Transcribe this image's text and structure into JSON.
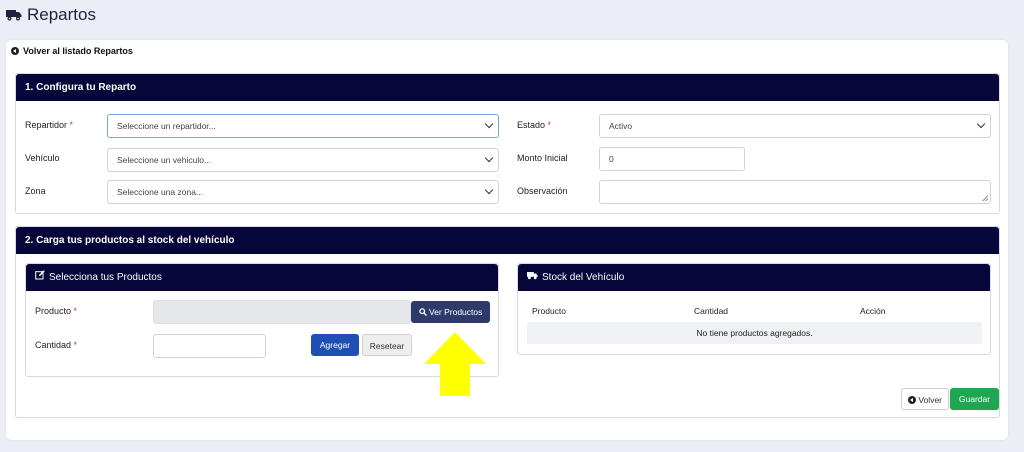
{
  "page": {
    "title": "Repartos",
    "title_icon": "truck-icon"
  },
  "back_link": {
    "label": "Volver al listado Repartos",
    "icon": "circle-arrow-left-icon"
  },
  "section1": {
    "title": "1. Configura tu Reparto",
    "fields": {
      "repartidor": {
        "label": "Repartidor",
        "required_mark": "*",
        "value": "Seleccione un repartidor..."
      },
      "vehiculo": {
        "label": "Vehículo",
        "value": "Seleccione un vehiculo..."
      },
      "zona": {
        "label": "Zona",
        "value": "Seleccione una zona..."
      },
      "estado": {
        "label": "Estado",
        "required_mark": "*",
        "value": "Activo"
      },
      "monto_inicial": {
        "label": "Monto Inicial",
        "value": "0"
      },
      "observacion": {
        "label": "Observación",
        "value": ""
      }
    }
  },
  "section2": {
    "title": "2. Carga tus productos al stock del vehículo",
    "select_panel": {
      "title": "Selecciona tus Productos",
      "icon": "edit-icon",
      "producto_label": "Producto",
      "producto_required": "*",
      "producto_value": "",
      "ver_productos_label": "Ver Productos",
      "ver_productos_icon": "search-icon",
      "cantidad_label": "Cantidad",
      "cantidad_required": "*",
      "cantidad_value": "",
      "agregar_label": "Agregar",
      "resetear_label": "Resetear"
    },
    "stock_panel": {
      "title": "Stock del Vehículo",
      "icon": "truck-icon",
      "columns": [
        "Producto",
        "Cantidad",
        "Acción"
      ],
      "empty_message": "No tiene productos agregados."
    }
  },
  "footer": {
    "volver_label": "Volver",
    "volver_icon": "circle-arrow-left-icon",
    "guardar_label": "Guardar"
  },
  "colors": {
    "header_bg": "#06063a",
    "accent_blue": "#1f4fb5",
    "success_green": "#1fa653",
    "highlight_arrow": "#ffff00",
    "required_red": "#d13b3b"
  }
}
